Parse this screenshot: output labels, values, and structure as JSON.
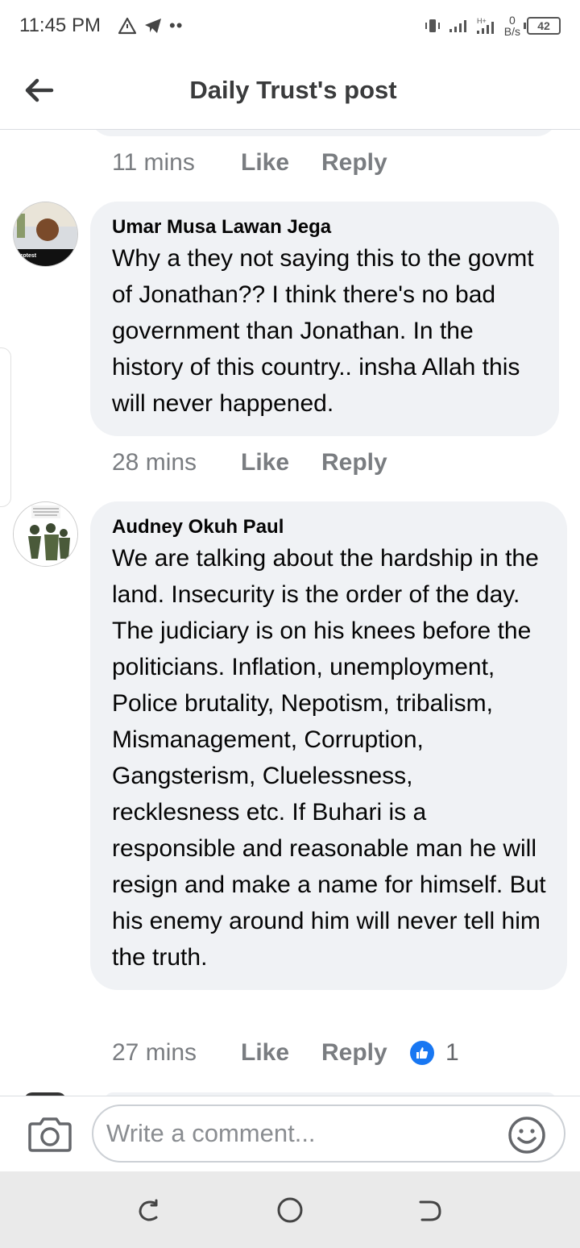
{
  "status_bar": {
    "time": "11:45 PM",
    "left_icons": [
      "alert-triangle-icon",
      "telegram-icon"
    ],
    "more_dots": "••",
    "net_speed_value": "0",
    "net_speed_unit": "B/s",
    "battery_level": "42"
  },
  "header": {
    "title": "Daily Trust's post",
    "back_icon": "arrow-left-icon"
  },
  "comments": [
    {
      "time": "11 mins",
      "like_label": "Like",
      "reply_label": "Reply"
    },
    {
      "author": "Umar Musa Lawan Jega",
      "text": "Why a they not saying this to the govmt of Jonathan?? I think there's no bad government than Jonathan. In the history of this country.. insha Allah this will never happened.",
      "time": "28 mins",
      "like_label": "Like",
      "reply_label": "Reply"
    },
    {
      "author": "Audney Okuh Paul",
      "text": "We are talking about the hardship in the land. Insecurity is the order of the day. The judiciary is on his knees before the politicians. Inflation, unemployment, Police brutality, Nepotism, tribalism, Mismanagement, Corruption, Gangsterism, Cluelessness, recklesness etc. If Buhari is a responsible and reasonable man he will resign and make a name for himself. But his enemy around him will never tell him the truth.",
      "time": "27 mins",
      "like_label": "Like",
      "reply_label": "Reply",
      "reaction_count": "1"
    }
  ],
  "composer": {
    "placeholder": "Write a comment...",
    "camera_icon": "camera-icon",
    "emoji_icon": "emoji-icon"
  },
  "colors": {
    "bubble": "#f0f2f5",
    "meta_text": "#7a7d81",
    "like_blue": "#1877f2"
  }
}
